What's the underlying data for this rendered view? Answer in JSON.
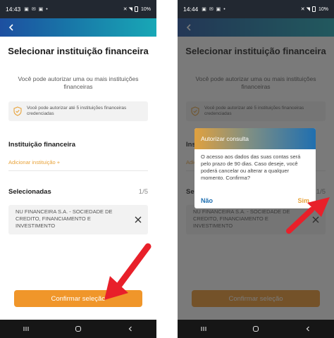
{
  "status_left": {
    "time": "14:43",
    "icons": "▣ ✉ ▣ •",
    "battery": "10%"
  },
  "status_right": {
    "time": "14:44",
    "icons": "▣ ✉ ▣ •",
    "battery": "10%"
  },
  "page": {
    "title": "Selecionar instituição financeira",
    "subtitle": "Você pode autorizar uma ou mais instituições financeiras",
    "info": "Você pode autorizar até 5 instituições financeiras credenciadas",
    "institution_label": "Instituição financeira",
    "add_link": "Adicionar instituição +",
    "selected_label": "Selecionadas",
    "selected_count": "1/5",
    "selected_item": "NU FINANCEIRA S.A. - SOCIEDADE DE CREDITO, FINANCIAMENTO E INVESTIMENTO",
    "confirm_button": "Confirmar seleção"
  },
  "dialog": {
    "title": "Autorizar consulta",
    "body": "O acesso aos dados das suas contas será pelo prazo de 90 dias. Caso deseje, você poderá cancelar ou alterar a qualquer momento. Confirma?",
    "no": "Não",
    "yes": "Sim"
  },
  "colors": {
    "accent_orange": "#f0962a",
    "header_blue": "#1877a8",
    "annotation_red": "#e8202a"
  },
  "icons": [
    "back-arrow-icon",
    "shield-check-icon",
    "close-icon",
    "recent-apps-icon",
    "home-icon",
    "back-nav-icon",
    "red-arrow-annotation"
  ]
}
